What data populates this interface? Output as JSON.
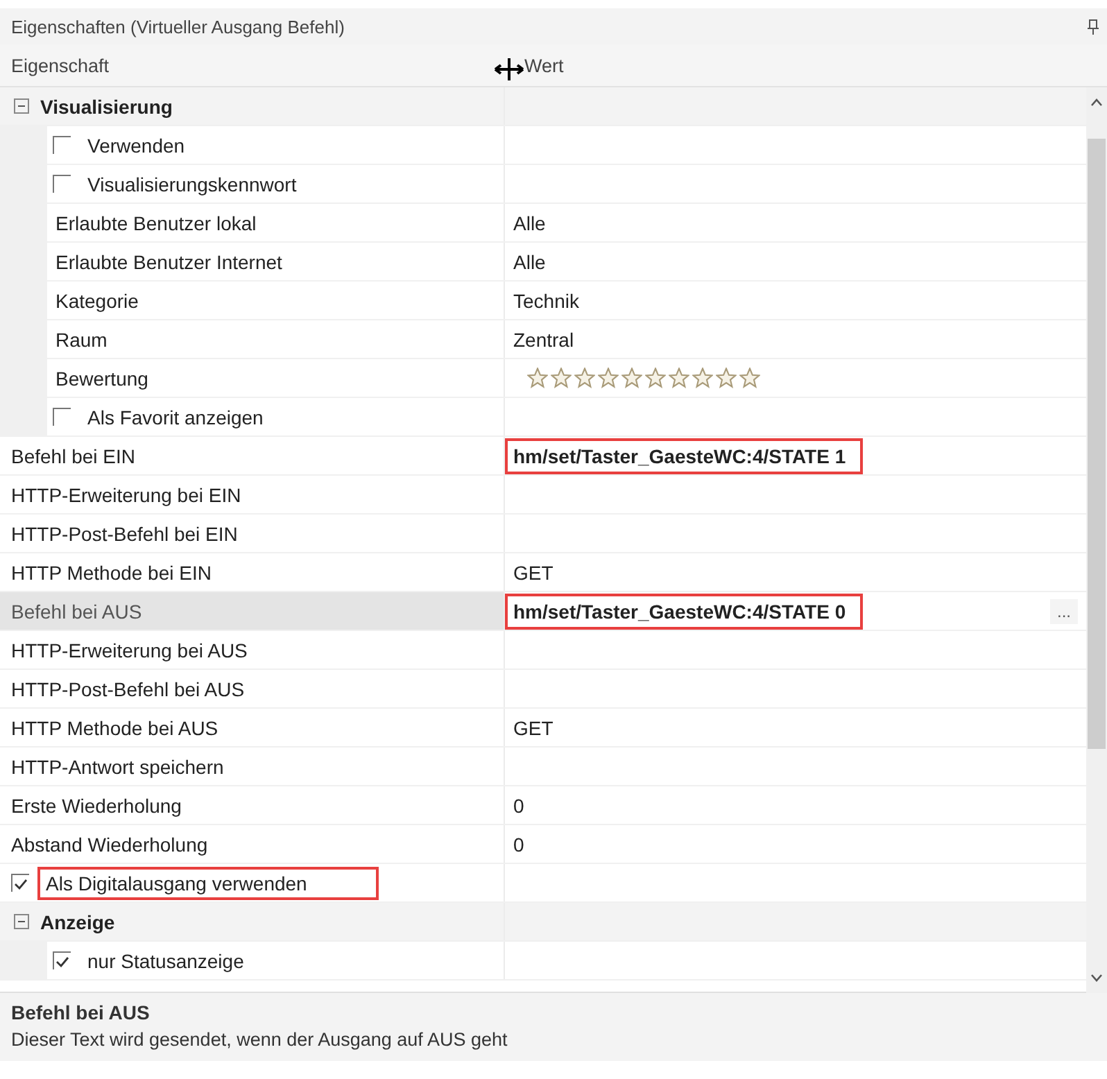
{
  "panel": {
    "title": "Eigenschaften (Virtueller Ausgang Befehl)"
  },
  "columns": [
    "Eigenschaft",
    "Wert"
  ],
  "rows": [
    {
      "kind": "category",
      "label": "Visualisierung",
      "expanded": true,
      "selected": false,
      "children": [
        {
          "kind": "checkbox",
          "label": "Verwenden",
          "checked": false,
          "selected": false
        },
        {
          "kind": "checkbox",
          "label": "Visualisierungskennwort",
          "checked": false,
          "selected": false
        },
        {
          "kind": "property",
          "label": "Erlaubte Benutzer lokal",
          "value": "Alle",
          "selected": false
        },
        {
          "kind": "property",
          "label": "Erlaubte Benutzer Internet",
          "value": "Alle",
          "selected": false
        },
        {
          "kind": "property",
          "label": "Kategorie",
          "value": "Technik",
          "selected": false
        },
        {
          "kind": "property",
          "label": "Raum",
          "value": "Zentral",
          "selected": false
        },
        {
          "kind": "rating",
          "label": "Bewertung",
          "stars": 0,
          "selected": false
        },
        {
          "kind": "checkbox",
          "label": "Als Favorit anzeigen",
          "checked": false,
          "selected": false
        }
      ]
    },
    {
      "kind": "property",
      "label": "Befehl bei EIN",
      "value": "hm/set/Taster_GaesteWC:4/STATE 1",
      "modified": true,
      "highlighted": true,
      "selected": false
    },
    {
      "kind": "property",
      "label": "HTTP-Erweiterung bei EIN",
      "selected": false
    },
    {
      "kind": "property",
      "label": "HTTP-Post-Befehl bei EIN",
      "selected": false
    },
    {
      "kind": "property",
      "label": "HTTP Methode bei EIN",
      "value": "GET",
      "selected": false
    },
    {
      "kind": "property",
      "label": "Befehl bei AUS",
      "value": "hm/set/Taster_GaesteWC:4/STATE 0",
      "modified": true,
      "highlighted": true,
      "selected": true,
      "button": "..."
    },
    {
      "kind": "property",
      "label": "HTTP-Erweiterung bei AUS",
      "selected": false
    },
    {
      "kind": "property",
      "label": "HTTP-Post-Befehl bei AUS",
      "selected": false
    },
    {
      "kind": "property",
      "label": "HTTP Methode bei AUS",
      "value": "GET",
      "selected": false
    },
    {
      "kind": "property",
      "label": "HTTP-Antwort speichern",
      "selected": false
    },
    {
      "kind": "property",
      "label": "Erste Wiederholung",
      "value": "0",
      "selected": false
    },
    {
      "kind": "property",
      "label": "Abstand Wiederholung",
      "value": "0",
      "selected": false
    },
    {
      "kind": "checkbox",
      "label": "Als Digitalausgang verwenden",
      "checked": true,
      "highlighted": true,
      "selected": false
    },
    {
      "kind": "category",
      "label": "Anzeige",
      "expanded": true,
      "selected": false,
      "children": [
        {
          "kind": "checkbox",
          "label": "nur Statusanzeige",
          "checked": true,
          "selected": false
        }
      ]
    }
  ],
  "description": {
    "title": "Befehl bei AUS",
    "text": "Dieser Text wird gesendet, wenn der Ausgang auf AUS geht"
  }
}
